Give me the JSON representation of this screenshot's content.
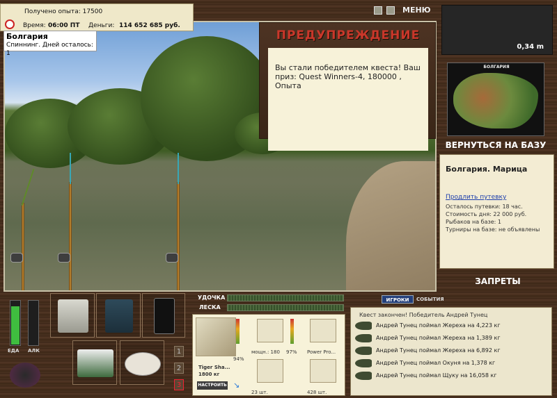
{
  "stats": {
    "experience": "Получено опыта: 17500",
    "time_label": "Время:",
    "time_value": "06:00 ПТ",
    "money_label": "Деньги:",
    "money_value": "114 652 685 руб."
  },
  "location": {
    "name": "Болгария",
    "subtitle": "Спиннинг. Дней осталось: 1"
  },
  "warning": {
    "title": "ПРЕДУПРЕЖДЕНИЕ",
    "message": "Вы стали победителем квеста! Ваш приз: Quest Winners-4, 180000 , Опыта"
  },
  "menu": {
    "label": "МЕНЮ"
  },
  "depth": {
    "value": "0,34 m"
  },
  "map": {
    "title": "БОЛГАРИЯ"
  },
  "nav": {
    "back_label": "ВЕРНУТЬСЯ НА БАЗУ",
    "bans_label": "ЗАПРЕТЫ"
  },
  "info": {
    "title": "Болгария. Марица",
    "link": "Продлить путевку",
    "lines": [
      "Осталось путевки: 18 час.",
      "Стоимость дня: 22 000 руб.",
      "Рыбаков на базе: 1",
      "Турниры на базе: не объявлены"
    ]
  },
  "meters": {
    "food": "ЕДА",
    "alcohol": "АЛК",
    "food_level": 0.88,
    "alcohol_level": 0.0
  },
  "slots": [
    "1",
    "2",
    "3"
  ],
  "tackle": {
    "rod_label": "УДОЧКА",
    "line_label": "ЛЕСКА",
    "rod_wear": "94%",
    "rod_name": "Tiger Sha...",
    "rod_length": "1800 кг",
    "setup_label": "НАСТРОИТЬ",
    "reel_power": "мощн.: 180",
    "reel_wear": "97%",
    "line_name": "Power Pro...",
    "hook_count": "23 шт.",
    "bait_count": "428 шт."
  },
  "events": {
    "tabs": [
      "ИГРОКИ",
      "СОБЫТИЯ"
    ],
    "header": "Квест закончен! Победитель Андрей Тунец",
    "rows": [
      "Андрей Тунец поймал Жереха на 4,223 кг",
      "Андрей Тунец поймал Жереха на 1,389 кг",
      "Андрей Тунец поймал Жереха на 6,892 кг",
      "Андрей Тунец поймал Окуня на 1,378 кг",
      "Андрей Тунец поймал Щуку на 16,058 кг"
    ]
  }
}
